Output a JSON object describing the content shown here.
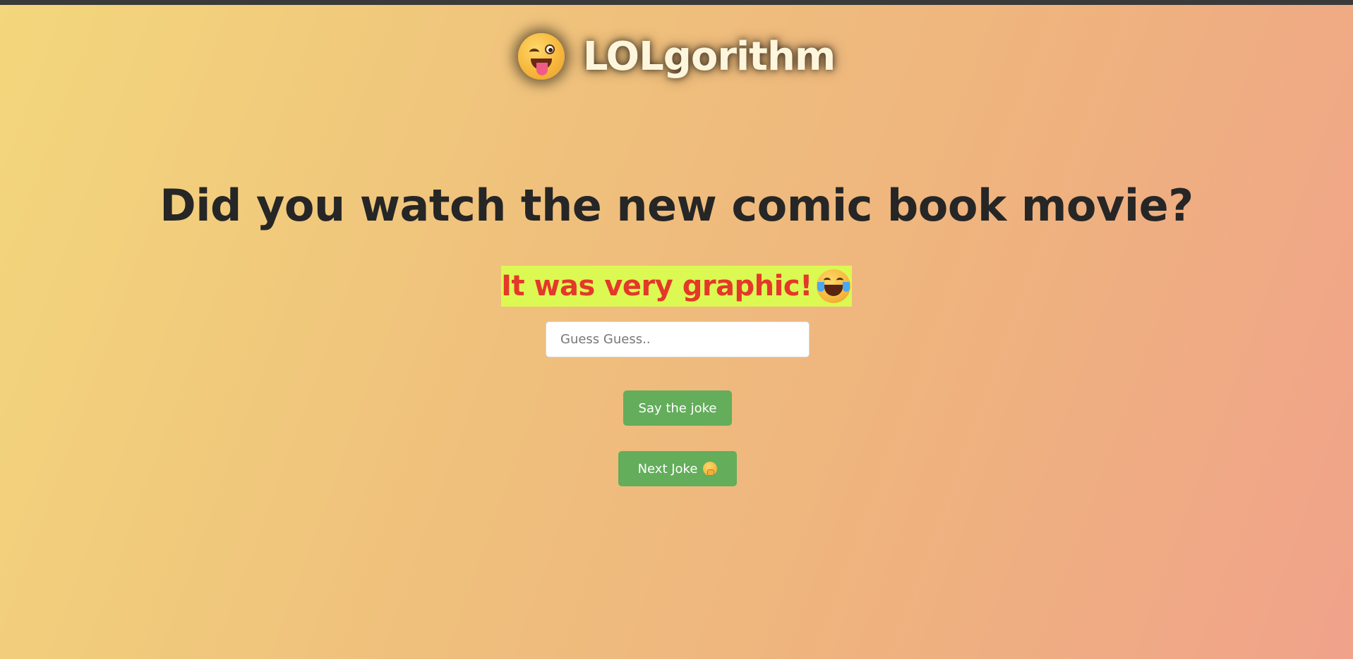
{
  "header": {
    "logo_icon": "winking-face-with-tongue-icon",
    "title": "LOLgorithm"
  },
  "joke": {
    "question": "Did you watch the new comic book movie?",
    "answer": "It was very graphic!",
    "answer_icon": "face-with-tears-of-joy-icon"
  },
  "guess": {
    "placeholder": "Guess Guess..",
    "value": ""
  },
  "buttons": {
    "say_label": "Say the joke",
    "next_label": "Next Joke",
    "next_icon": "face-with-hand-over-mouth-icon"
  },
  "colors": {
    "button_bg": "#63ad5b",
    "answer_highlight": "#dcf852",
    "answer_text": "#e4382a",
    "question_text": "#262626",
    "title_text": "#fdf6dc"
  }
}
